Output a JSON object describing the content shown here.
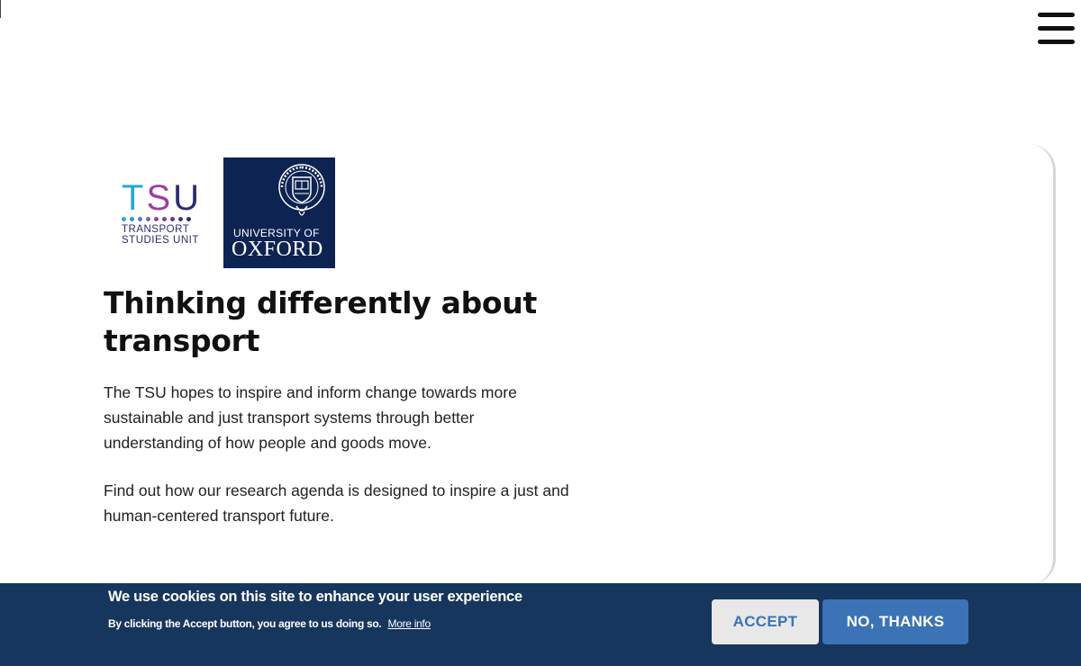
{
  "header": {
    "menu_icon": "hamburger-menu-icon"
  },
  "logos": {
    "tsu": {
      "letters": [
        "T",
        "S",
        "U"
      ],
      "subtitle_line1": "TRANSPORT",
      "subtitle_line2": "STUDIES UNIT",
      "colors": {
        "t": "#29a7d8",
        "s": "#9b3fa0",
        "u": "#2b2d6e"
      }
    },
    "oxford": {
      "line1": "UNIVERSITY OF",
      "line2": "OXFORD",
      "background": "#0d2352",
      "seal_icon": "university-seal-icon"
    }
  },
  "hero": {
    "heading": "Thinking differently about transport",
    "paragraph1": "The TSU hopes to inspire and inform change towards more sustainable and just transport systems through better understanding of how people and goods move.",
    "paragraph2": "Find out how our research agenda is designed to inspire a just and human-centered transport future."
  },
  "cookie_banner": {
    "title": "We use cookies on this site to enhance your user experience",
    "description": "By clicking the Accept button, you agree to us doing so.",
    "more_info": "More info",
    "accept_label": "ACCEPT",
    "decline_label": "NO, THANKS",
    "colors": {
      "background": "#17365d",
      "accent": "#3b73b6"
    }
  }
}
